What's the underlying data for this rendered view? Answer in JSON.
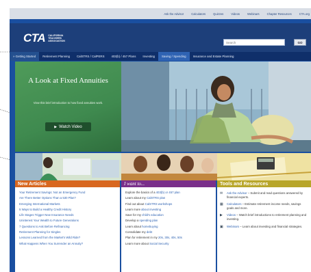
{
  "top_links": [
    "Ask the Advisor",
    "Calculators",
    "Quizzes",
    "Videos",
    "Webinars",
    "Chapter Resources",
    "CTA.org"
  ],
  "header": {
    "logo_mark": "CTA",
    "logo_text": "California Teachers Association",
    "search_placeholder": "Search",
    "go_label": "GO"
  },
  "nav": [
    "» Getting Started",
    "Retirement Planning",
    "CalSTRS / CalPERS",
    "403(b) / 457 Plans",
    "Investing",
    "Saving / Spending",
    "Insurance and Estate Planning"
  ],
  "hero": {
    "title": "A Look at Fixed Annuities",
    "subtitle": "View this brief introduction to how fixed annuities work.",
    "button_label": "Watch Video"
  },
  "new_articles": {
    "heading": "New Articles",
    "items": [
      "Your Retirement Savings: Not an Emergency Fund",
      "Are There Better Options Than a 530 Plan?",
      "Emerging International Markets",
      "5 Ways to Build a Healthy Credit History",
      "Life Stages Trigger New Insurance Needs",
      "Uninterest Your Wealth to Future Generations",
      "7 Questions to Ask Before Refinancing",
      "Retirement Planning for Singles",
      "Lessons Learned from the Market's Wild Ride?",
      "What Happens When You Surrender an Annuity?"
    ]
  },
  "i_want_to": {
    "heading": "I want to...",
    "items": [
      {
        "pre": "Explore the basics of a ",
        "link": "403(b) or 457 plan",
        "post": ""
      },
      {
        "pre": "Learn about my ",
        "link": "CalSTRS plan",
        "post": ""
      },
      {
        "pre": "Find out about ",
        "link": "CalSTRS workshops",
        "post": ""
      },
      {
        "pre": "Learn more ",
        "link": "about investing",
        "post": ""
      },
      {
        "pre": "Save for my ",
        "link": "child's education",
        "post": ""
      },
      {
        "pre": "Develop a ",
        "link": "spending plan",
        "post": ""
      },
      {
        "pre": "Learn about ",
        "link": "homebuying",
        "post": ""
      },
      {
        "pre": "Consolidate my ",
        "link": "debt",
        "post": ""
      },
      {
        "pre": "Plan for retirement in my ",
        "link": "20s, 30s, 40s, 50s",
        "post": ""
      },
      {
        "pre": "Learn more about ",
        "link": "Social Security",
        "post": ""
      }
    ]
  },
  "tools": {
    "heading": "Tools and Resources",
    "items": [
      {
        "icon": "chat-icon",
        "glyph": "✉",
        "link": "Ask the Advisor",
        "text": " – Submit and read questions answered by financial experts."
      },
      {
        "icon": "calculator-icon",
        "glyph": "▦",
        "link": "Calculators",
        "text": " – Estimate retirement income needs, savings goals and more."
      },
      {
        "icon": "video-icon",
        "glyph": "▶",
        "link": "Videos",
        "text": " – Watch brief introductions to retirement planning and investing."
      },
      {
        "icon": "webinar-icon",
        "glyph": "▣",
        "link": "Webinars",
        "text": " – Learn about investing and financial strategies."
      }
    ]
  },
  "colors": {
    "frame": "#1a4fa0",
    "navbar": "#0f2f6a",
    "hero_green": "#4f9b5a",
    "articles_orange": "#d8671f",
    "iwant_purple": "#7a2f8a",
    "tools_olive": "#b8a62a",
    "link_blue": "#2a5fb0"
  }
}
